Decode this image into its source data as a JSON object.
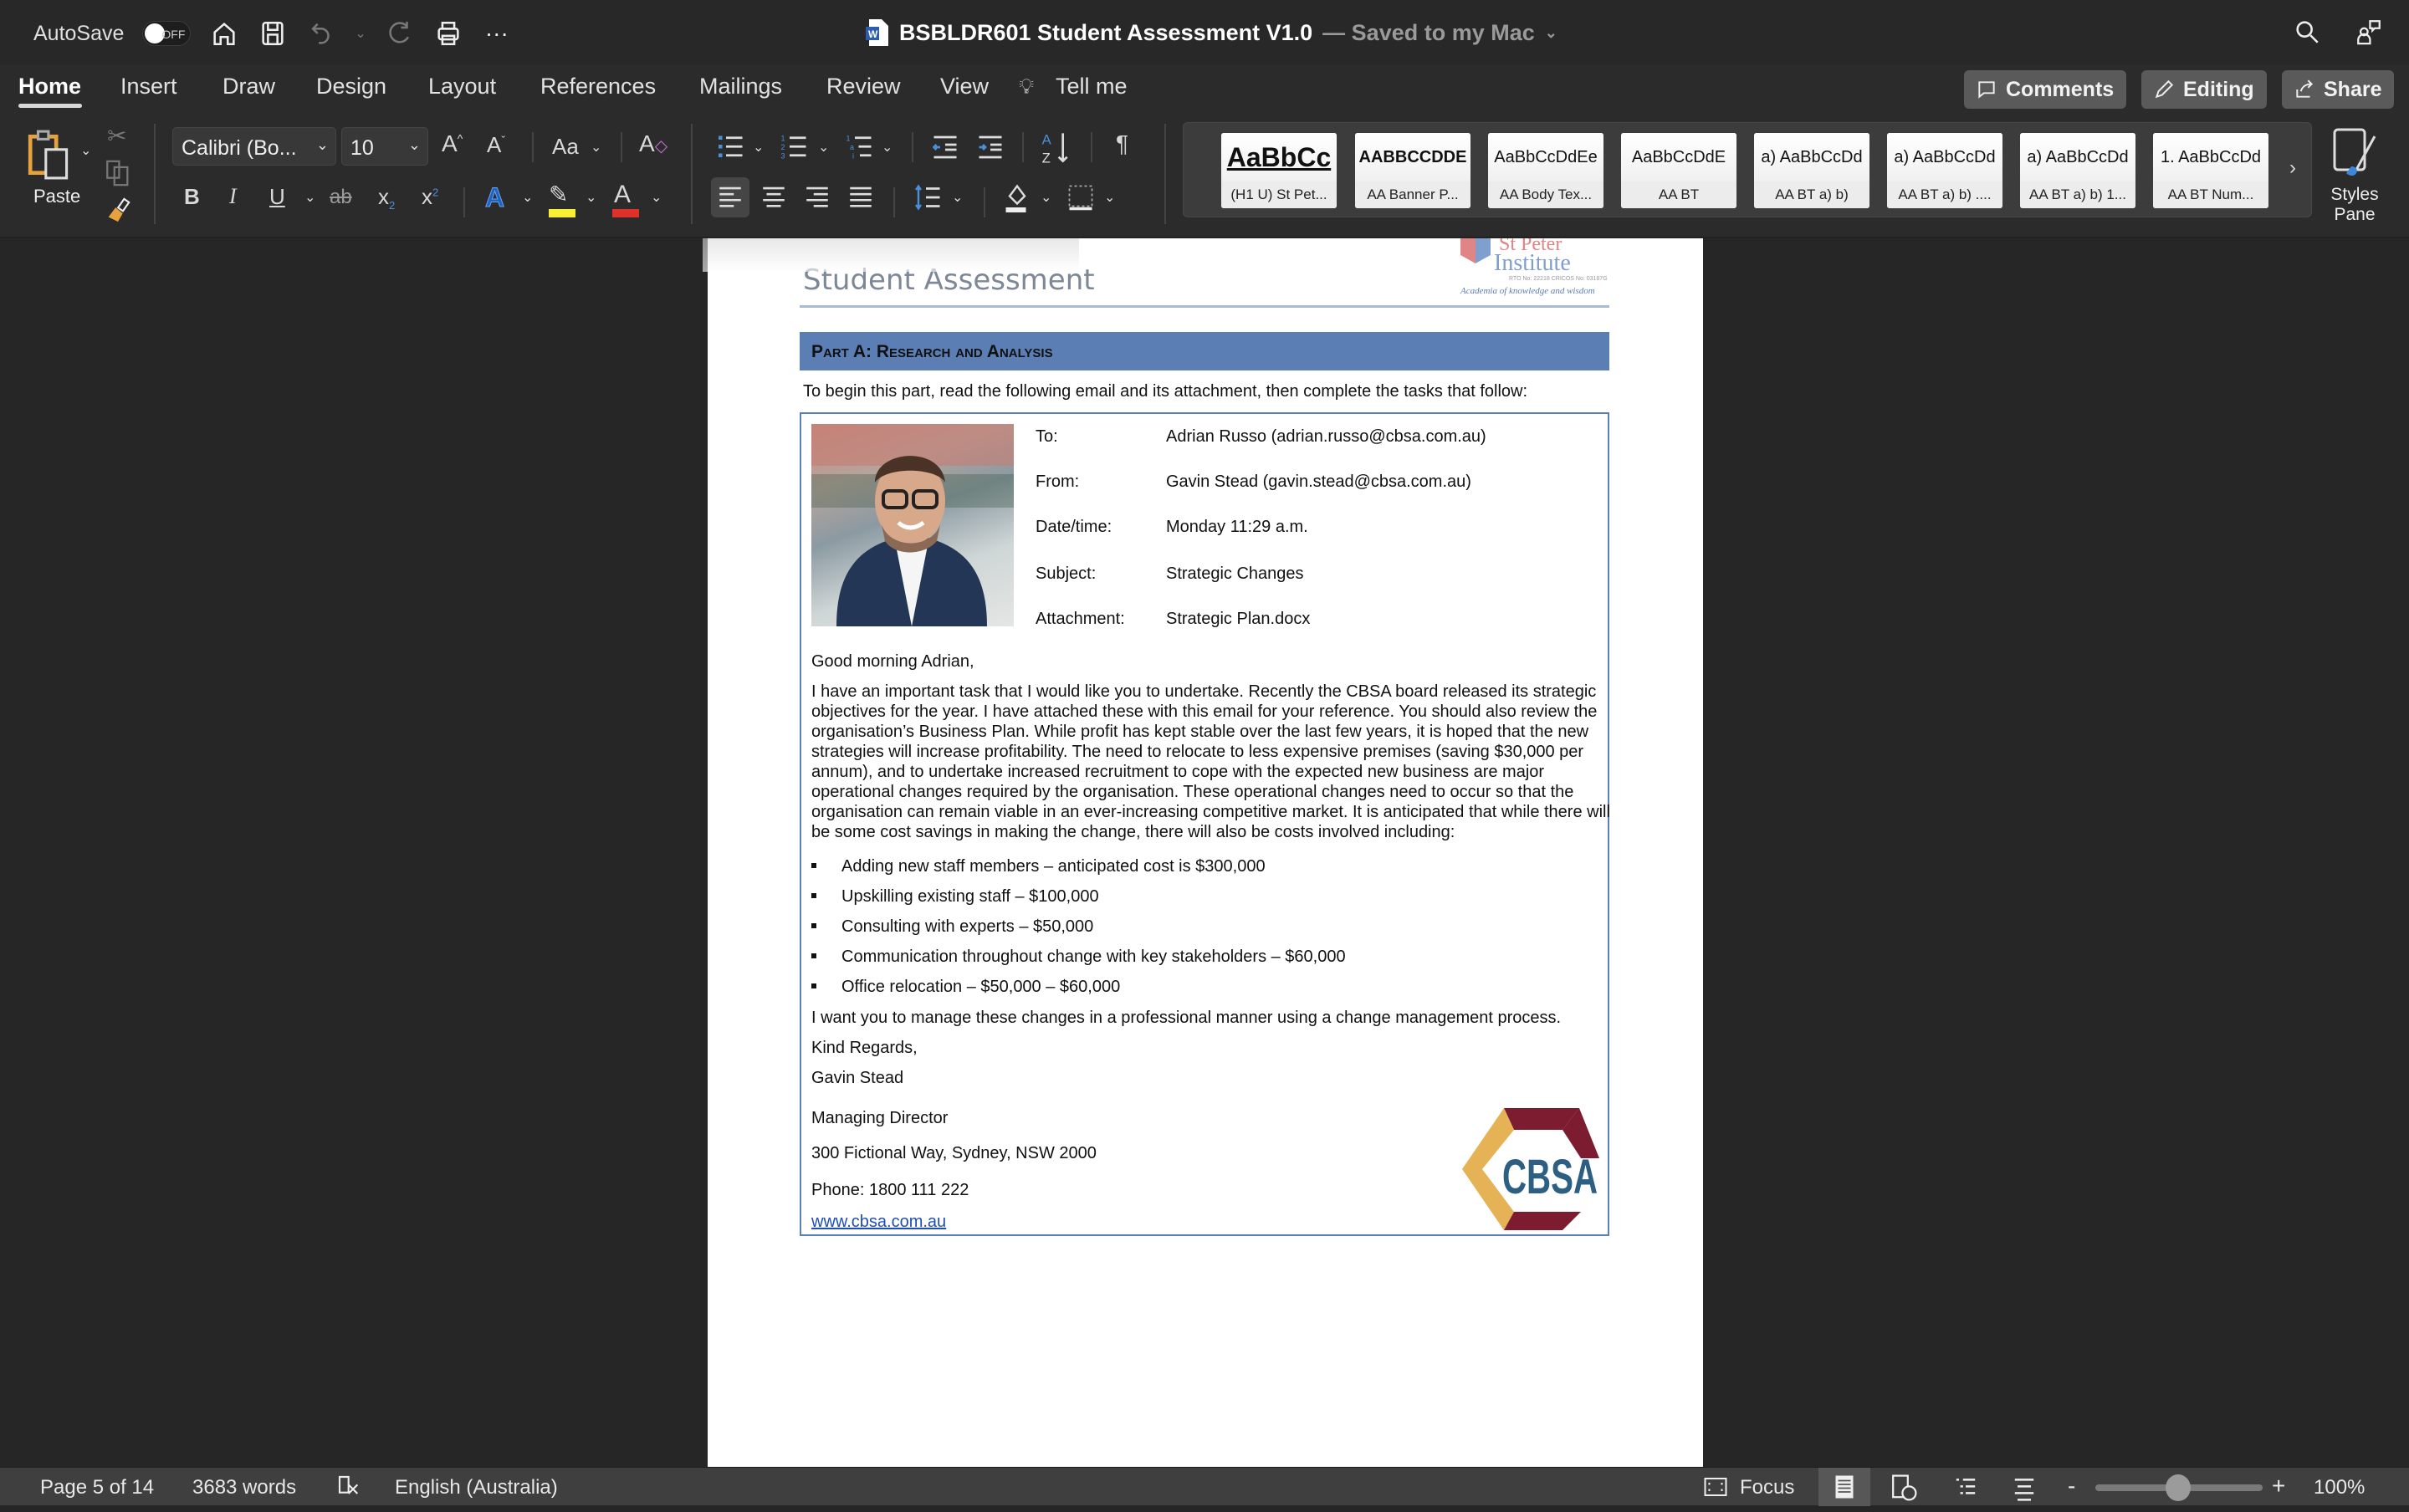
{
  "titlebar": {
    "autosave_label": "AutoSave",
    "autosave_state": "OFF",
    "doc_name": "BSBLDR601 Student Assessment V1.0",
    "saved_status": "— Saved to my Mac",
    "icons": [
      "home-icon",
      "save-icon",
      "undo-icon",
      "redo-icon",
      "print-icon",
      "more-icon",
      "search-icon",
      "share-people-icon"
    ]
  },
  "tabs": [
    {
      "label": "Home",
      "active": true
    },
    {
      "label": "Insert"
    },
    {
      "label": "Draw"
    },
    {
      "label": "Design"
    },
    {
      "label": "Layout"
    },
    {
      "label": "References"
    },
    {
      "label": "Mailings"
    },
    {
      "label": "Review"
    },
    {
      "label": "View"
    },
    {
      "label": "Tell me"
    }
  ],
  "top_buttons": {
    "comments": "Comments",
    "editing": "Editing",
    "share": "Share"
  },
  "ribbon": {
    "paste_label": "Paste",
    "font_name": "Calibri (Bo...",
    "font_size": "10",
    "highlight_color": "#f5f033",
    "font_color": "#e0302a",
    "styles": [
      {
        "sample": "AaBbCc",
        "label": "(H1 U) St Pet..."
      },
      {
        "sample": "AABBCCDDE",
        "label": "AA Banner P..."
      },
      {
        "sample": "AaBbCcDdEe",
        "label": "AA Body Tex..."
      },
      {
        "sample": "AaBbCcDdE",
        "label": "AA BT"
      },
      {
        "sample": "a)  AaBbCcDd",
        "label": "AA BT a) b)"
      },
      {
        "sample": "a)  AaBbCcDd",
        "label": "AA BT a) b) ...."
      },
      {
        "sample": "a)  AaBbCcDd",
        "label": "AA BT a) b) 1..."
      },
      {
        "sample": "1.  AaBbCcDd",
        "label": "AA BT Num..."
      }
    ],
    "styles_pane": "Styles Pane"
  },
  "document": {
    "header_title": "Student Assessment",
    "logo_text": {
      "line1": "St Peter",
      "line2": "Institute",
      "rto": "RTO No: 22218   CRICOS No: 03187G",
      "tagline": "Academia of knowledge and wisdom"
    },
    "banner": "Part A: Research and Analysis",
    "intro": "To begin this part, read the following email and its attachment, then complete the tasks that follow:",
    "email": {
      "meta": [
        {
          "key": "To:",
          "value": "Adrian Russo (adrian.russo@cbsa.com.au)"
        },
        {
          "key": "From:",
          "value": "Gavin Stead (gavin.stead@cbsa.com.au)"
        },
        {
          "key": "Date/time:",
          "value": "Monday 11:29 a.m."
        },
        {
          "key": "Subject:",
          "value": "Strategic Changes"
        },
        {
          "key": "Attachment:",
          "value": "Strategic Plan.docx"
        }
      ],
      "greeting": "Good morning Adrian,",
      "paragraph": "I have an important task that I would like you to undertake. Recently the CBSA board released its strategic objectives for the year. I have attached these with this email for your reference. You should also review the organisation’s Business Plan. While profit has kept stable over the last few years, it is hoped that the new strategies will increase profitability. The need to relocate to less expensive premises (saving $30,000 per annum), and to undertake increased recruitment to cope with the expected new business are major operational changes required by the organisation. These operational changes need to occur so that the organisation can remain viable in an ever-increasing competitive market. It is anticipated that while there will be some cost savings in making the change, there will also be costs involved including:",
      "bullets": [
        "Adding new staff members – anticipated cost is $300,000",
        "Upskilling existing staff – $100,000",
        "Consulting with experts – $50,000",
        "Communication throughout change with key stakeholders – $60,000",
        "Office relocation – $50,000 – $60,000"
      ],
      "closing_line": "I want you to manage these changes in a professional manner using a change management process.",
      "signoff": "Kind Regards,",
      "sender": "Gavin Stead",
      "title": "Managing Director",
      "address": "300 Fictional Way, Sydney, NSW 2000",
      "phone": "Phone: 1800 111 222",
      "website": "www.cbsa.com.au",
      "company_logo": "CBSA"
    }
  },
  "statusbar": {
    "page": "Page 5 of 14",
    "words": "3683 words",
    "language": "English (Australia)",
    "focus": "Focus",
    "zoom": "100%",
    "zoom_percent": 100
  }
}
